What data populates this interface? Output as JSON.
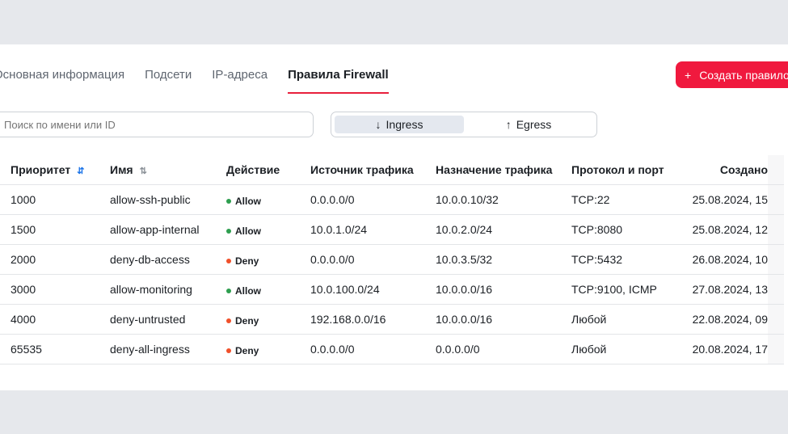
{
  "tabs": [
    {
      "label": "Основная информация"
    },
    {
      "label": "Подсети"
    },
    {
      "label": "IP-адреса"
    },
    {
      "label": "Правила Firewall",
      "active": true
    }
  ],
  "create_button": {
    "icon": "plus-icon",
    "label": "Создать правило"
  },
  "search": {
    "placeholder": "Поиск по имени или ID",
    "value": ""
  },
  "direction": {
    "options": [
      {
        "label": "Ingress",
        "icon": "arrow-down-icon",
        "selected": true
      },
      {
        "label": "Egress",
        "icon": "arrow-up-icon",
        "selected": false
      }
    ]
  },
  "colors": {
    "accent": "#f0193e",
    "allow": "#2e9e4f",
    "deny": "#f0502a",
    "sort_active": "#1a73e8"
  },
  "table": {
    "headers": [
      "Приоритет",
      "Имя",
      "Действие",
      "Источник трафика",
      "Назначение трафика",
      "Протокол и порт",
      "Создано"
    ],
    "rows": [
      [
        "1000",
        "allow-ssh-public",
        "Allow",
        "0.0.0.0/0",
        "10.0.0.10/32",
        "TCP:22",
        "25.08.2024, 15"
      ],
      [
        "1500",
        "allow-app-internal",
        "Allow",
        "10.0.1.0/24",
        "10.0.2.0/24",
        "TCP:8080",
        "25.08.2024, 12"
      ],
      [
        "2000",
        "deny-db-access",
        "Deny",
        "0.0.0.0/0",
        "10.0.3.5/32",
        "TCP:5432",
        "26.08.2024, 10"
      ],
      [
        "3000",
        "allow-monitoring",
        "Allow",
        "10.0.100.0/24",
        "10.0.0.0/16",
        "TCP:9100, ICMP",
        "27.08.2024, 13"
      ],
      [
        "4000",
        "deny-untrusted",
        "Deny",
        "192.168.0.0/16",
        "10.0.0.0/16",
        "Любой",
        "22.08.2024, 09"
      ],
      [
        "65535",
        "deny-all-ingress",
        "Deny",
        "0.0.0.0/0",
        "0.0.0.0/0",
        "Любой",
        "20.08.2024, 17"
      ]
    ]
  }
}
